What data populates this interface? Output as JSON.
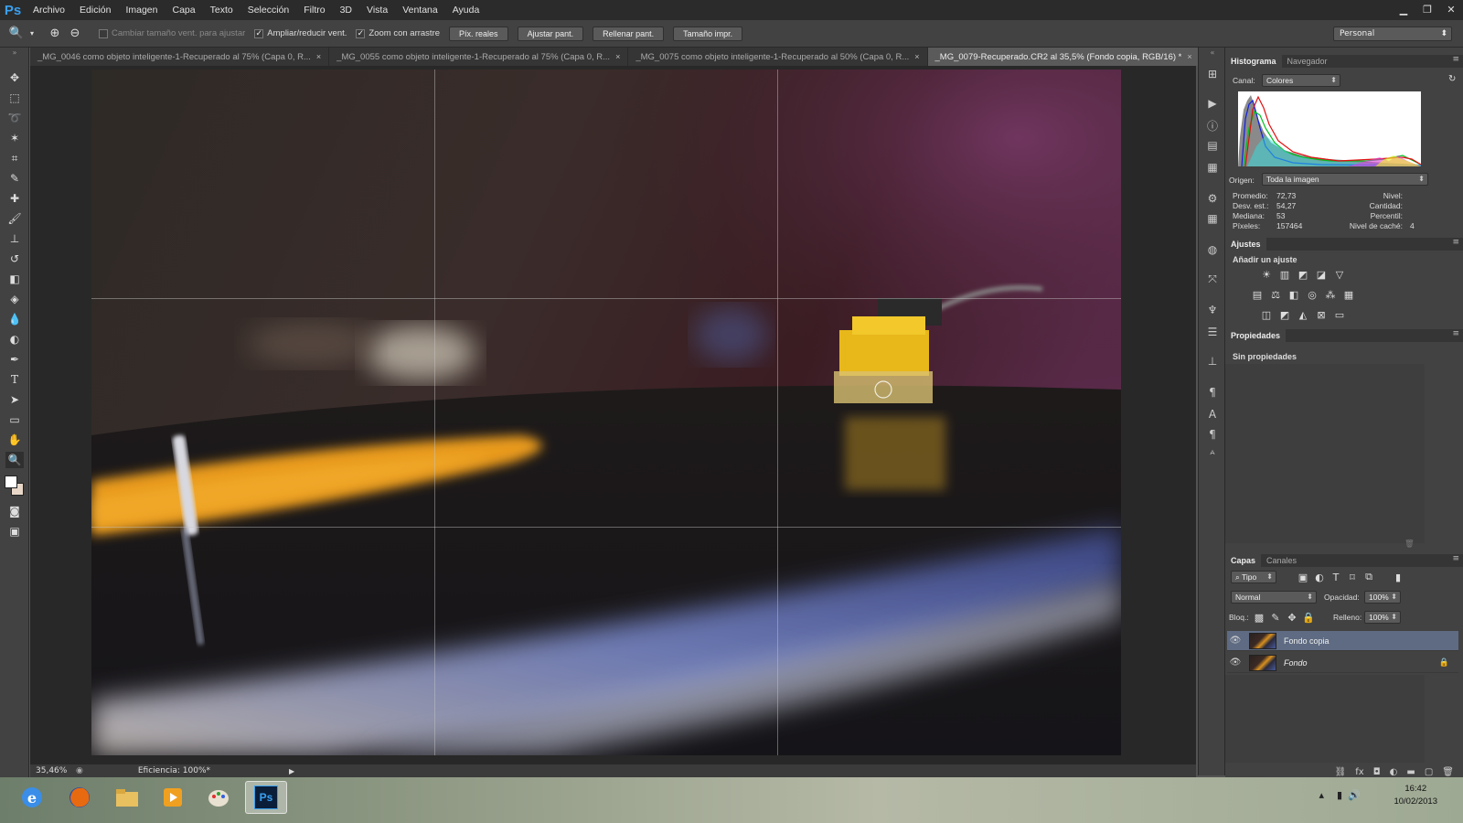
{
  "app": {
    "logo": "Ps"
  },
  "menu": [
    "Archivo",
    "Edición",
    "Imagen",
    "Capa",
    "Texto",
    "Selección",
    "Filtro",
    "3D",
    "Vista",
    "Ventana",
    "Ayuda"
  ],
  "options": {
    "resize_windows_label": "Cambiar tamaño vent. para ajustar",
    "zoom_windows_label": "Ampliar/reducir vent.",
    "scrubby_zoom_label": "Zoom con arrastre",
    "actual_pixels_label": "Píx. reales",
    "fit_screen_label": "Ajustar pant.",
    "fill_screen_label": "Rellenar pant.",
    "print_size_label": "Tamaño impr.",
    "workspace": "Personal"
  },
  "tabs": [
    {
      "label": "_MG_0046 como objeto inteligente-1-Recuperado al 75% (Capa 0, R...",
      "close": "×"
    },
    {
      "label": "_MG_0055 como objeto inteligente-1-Recuperado al 75% (Capa 0, R...",
      "close": "×"
    },
    {
      "label": "_MG_0075 como objeto inteligente-1-Recuperado al 50% (Capa 0, R...",
      "close": "×"
    },
    {
      "label": "_MG_0079-Recuperado.CR2 al 35,5% (Fondo copia, RGB/16) *",
      "close": "×"
    }
  ],
  "status": {
    "zoom": "35,46%",
    "efficiency": "Eficiencia: 100%*"
  },
  "histogram": {
    "tabs": [
      "Histograma",
      "Navegador"
    ],
    "channel_label": "Canal:",
    "channel_value": "Colores",
    "source_label": "Origen:",
    "source_value": "Toda la imagen",
    "stats_left": [
      {
        "label": "Promedio:",
        "value": "72,73"
      },
      {
        "label": "Desv. est.:",
        "value": "54,27"
      },
      {
        "label": "Mediana:",
        "value": "53"
      },
      {
        "label": "Píxeles:",
        "value": "157464"
      }
    ],
    "stats_right": [
      {
        "label": "Nivel:",
        "value": ""
      },
      {
        "label": "Cantidad:",
        "value": ""
      },
      {
        "label": "Percentil:",
        "value": ""
      },
      {
        "label": "Nivel de caché:",
        "value": "4"
      }
    ]
  },
  "adjustments": {
    "tab": "Ajustes",
    "heading": "Añadir un ajuste"
  },
  "properties": {
    "tab": "Propiedades",
    "empty_text": "Sin propiedades"
  },
  "layers": {
    "tabs": [
      "Capas",
      "Canales"
    ],
    "filter_label": "Tipo",
    "blend_mode": "Normal",
    "opacity_label": "Opacidad:",
    "opacity_value": "100%",
    "lock_label": "Bloq.:",
    "fill_label": "Relleno:",
    "fill_value": "100%",
    "items": [
      {
        "name": "Fondo copia",
        "selected": true,
        "locked": false
      },
      {
        "name": "Fondo",
        "selected": false,
        "locked": true
      }
    ]
  },
  "taskbar": {
    "time": "16:42",
    "date": "10/02/2013"
  },
  "colors": {
    "accent": "#3aa0f0",
    "selected_layer": "#5e6b82",
    "panel_bg": "#424242"
  }
}
